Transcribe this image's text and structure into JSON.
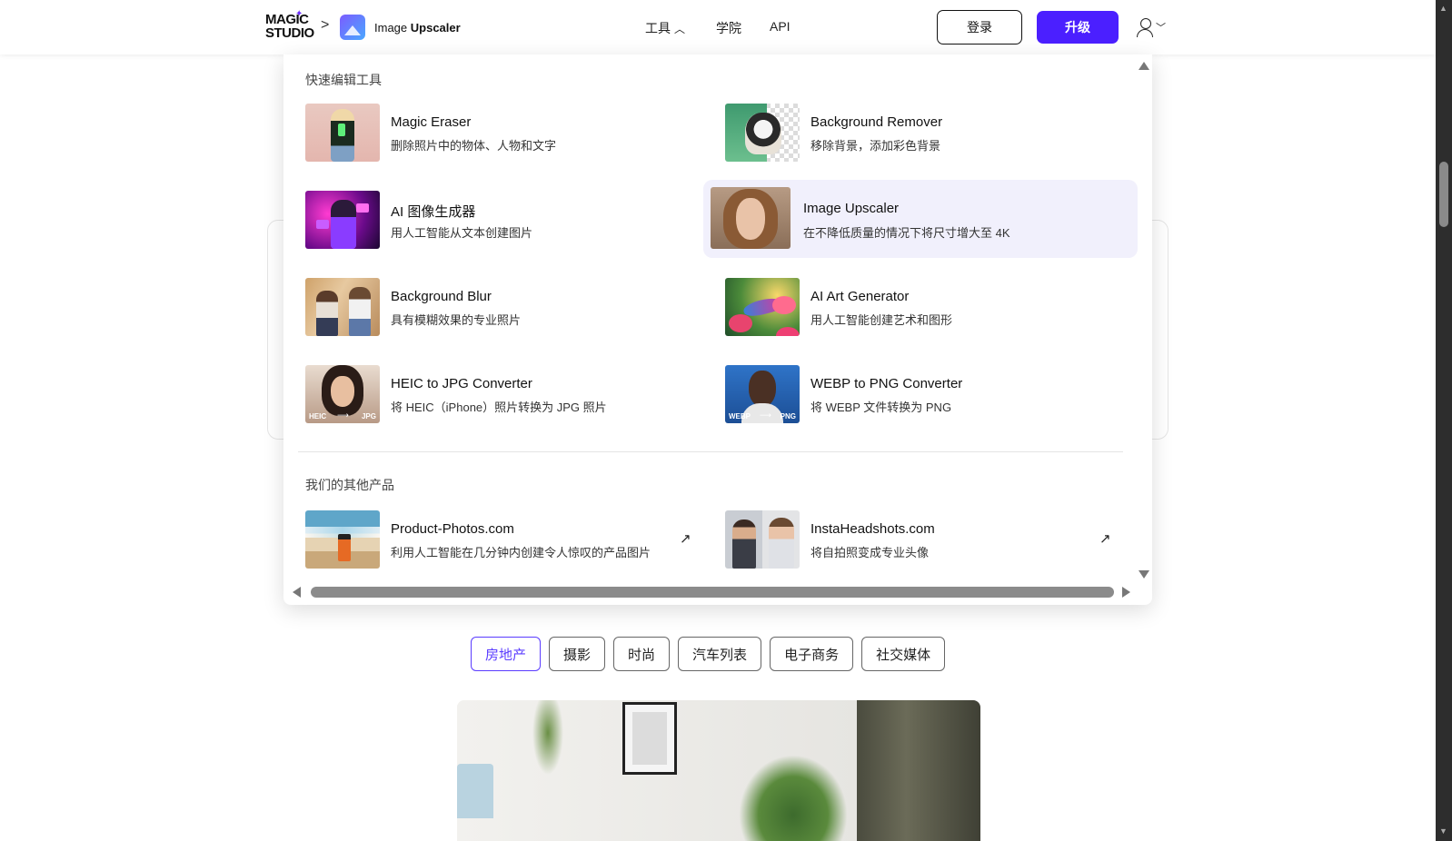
{
  "header": {
    "logo_line1": "MAGIC",
    "logo_line2": "STUDIO",
    "breadcrumb_sep": ">",
    "app_name_light": "Image",
    "app_name_bold": "Upscaler",
    "nav": {
      "tools": "工具",
      "academy": "学院",
      "api": "API"
    },
    "login_label": "登录",
    "upgrade_label": "升级",
    "accent_color": "#4b1fff"
  },
  "dropdown": {
    "quick_tools_title": "快速编辑工具",
    "tools": [
      {
        "name": "Magic Eraser",
        "desc": "删除照片中的物体、人物和文字"
      },
      {
        "name": "Background Remover",
        "desc": "移除背景，添加彩色背景"
      },
      {
        "name": "AI 图像生成器",
        "desc": "用人工智能从文本创建图片"
      },
      {
        "name": "Image Upscaler",
        "desc": "在不降低质量的情况下将尺寸增大至 4K"
      },
      {
        "name": "Background Blur",
        "desc": "具有模糊效果的专业照片"
      },
      {
        "name": "AI Art Generator",
        "desc": "用人工智能创建艺术和图形"
      },
      {
        "name": "HEIC to JPG Converter",
        "desc": "将 HEIC（iPhone）照片转换为 JPG 照片"
      },
      {
        "name": "WEBP to PNG Converter",
        "desc": "将 WEBP 文件转换为 PNG"
      }
    ],
    "thumb_labels": {
      "heic": "HEIC",
      "jpg": "JPG",
      "webp": "WEBP",
      "png": "PNG"
    },
    "other_products_title": "我们的其他产品",
    "products": [
      {
        "name": "Product-Photos.com",
        "desc": "利用人工智能在几分钟内创建令人惊叹的产品图片"
      },
      {
        "name": "InstaHeadshots.com",
        "desc": "将自拍照变成专业头像"
      }
    ]
  },
  "categories": {
    "tabs": [
      "房地产",
      "摄影",
      "时尚",
      "汽车列表",
      "电子商务",
      "社交媒体"
    ],
    "active": "房地产"
  }
}
